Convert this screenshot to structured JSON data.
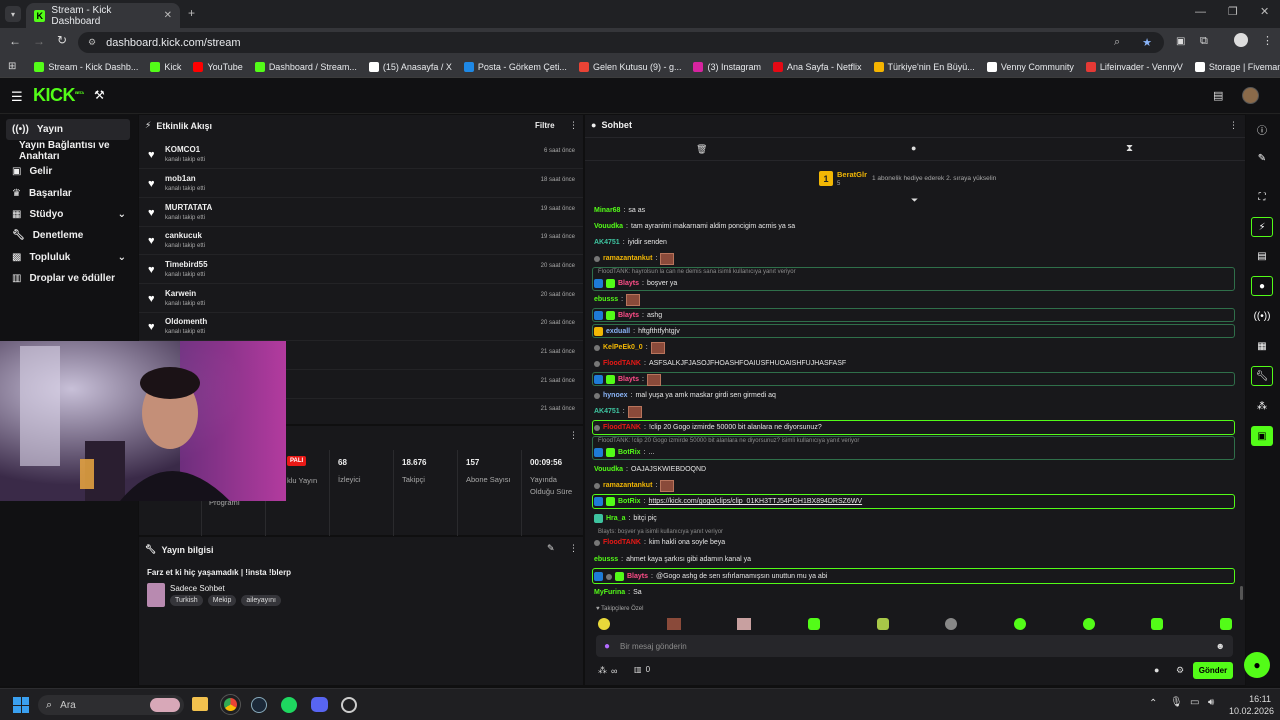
{
  "browser": {
    "tab_title": "Stream - Kick Dashboard",
    "url": "dashboard.kick.com/stream",
    "bookmarks": [
      {
        "label": "Stream - Kick Dashb...",
        "color": "#53fc18"
      },
      {
        "label": "Kick",
        "color": "#53fc18"
      },
      {
        "label": "YouTube",
        "color": "#ff0000"
      },
      {
        "label": "Dashboard / Stream...",
        "color": "#53fc18"
      },
      {
        "label": "(15) Anasayfa / X",
        "color": "#ffffff"
      },
      {
        "label": "Posta - Görkem Çeti...",
        "color": "#1e88e5"
      },
      {
        "label": "Gelen Kutusu (9) - g...",
        "color": "#ea4335"
      },
      {
        "label": "(3) Instagram",
        "color": "#d6249f"
      },
      {
        "label": "Ana Sayfa - Netflix",
        "color": "#e50914"
      },
      {
        "label": "Türkiye'nin En Büyü...",
        "color": "#f5b400"
      },
      {
        "label": "Venny Community",
        "color": "#ffffff"
      },
      {
        "label": "Lifeinvader - VennyV",
        "color": "#e53935"
      },
      {
        "label": "Storage | Fivemanage",
        "color": "#ffffff"
      }
    ]
  },
  "app": {
    "logo": "KICK",
    "logo_sup": "BETA",
    "accent": "#53fc18"
  },
  "sidebar": {
    "items": [
      {
        "label": "Yayın",
        "icon": "broadcast-icon"
      },
      {
        "label": "Yayın Bağlantısı ve Anahtarı",
        "icon": "key-icon"
      },
      {
        "label": "Gelir",
        "icon": "wallet-icon"
      },
      {
        "label": "Başarılar",
        "icon": "trophy-icon"
      },
      {
        "label": "Stüdyo",
        "icon": "studio-icon"
      },
      {
        "label": "Denetleme",
        "icon": "wrench-icon"
      },
      {
        "label": "Topluluk",
        "icon": "community-icon"
      },
      {
        "label": "Droplar ve ödüller",
        "icon": "gift-icon"
      }
    ]
  },
  "activity": {
    "title": "Etkinlik Akışı",
    "filter": "Filtre",
    "rows": [
      {
        "name": "KOMCO1",
        "sub": "kanalı takip etti",
        "time": "6 saat önce"
      },
      {
        "name": "mob1an",
        "sub": "kanalı takip etti",
        "time": "18 saat önce"
      },
      {
        "name": "MURTATATA",
        "sub": "kanalı takip etti",
        "time": "19 saat önce"
      },
      {
        "name": "cankucuk",
        "sub": "kanalı takip etti",
        "time": "19 saat önce"
      },
      {
        "name": "Timebird55",
        "sub": "kanalı takip etti",
        "time": "20 saat önce"
      },
      {
        "name": "Karwein",
        "sub": "kanalı takip etti",
        "time": "20 saat önce"
      },
      {
        "name": "Oldomenth",
        "sub": "kanalı takip etti",
        "time": "20 saat önce"
      },
      {
        "name": "",
        "sub": "",
        "time": "21 saat önce"
      },
      {
        "name": "",
        "sub": "",
        "time": "21 saat önce"
      },
      {
        "name": "",
        "sub": "",
        "time": "21 saat önce"
      }
    ]
  },
  "stats": {
    "live_badge": "PALI",
    "program_label": "Programı",
    "live_label": "klu Yayın",
    "items": [
      {
        "value": "68",
        "label": "İzleyici"
      },
      {
        "value": "18.676",
        "label": "Takipçi"
      },
      {
        "value": "157",
        "label": "Abone Sayısı"
      },
      {
        "value": "00:09:56",
        "label": "Yayında Olduğu Süre"
      }
    ]
  },
  "stream_info": {
    "title": "Yayın bilgisi",
    "stream_title": "Farz et ki hiç yaşamadık | !insta !blerp",
    "category": "Sadece Sohbet",
    "tags": [
      "Turkish",
      "Mekip",
      "aileyayını"
    ]
  },
  "chat": {
    "title": "Sohbet",
    "pinned_user": "BeratGlr",
    "pinned_rank": "1",
    "pinned_level": "5",
    "pinned_text": "1 abonelik hediye ederek 2. sıraya yükselin",
    "input_placeholder": "Bir mesaj gönderin",
    "send_label": "Gönder",
    "points": "∞",
    "count": "0",
    "follower_label": "Takipçilere Özel"
  },
  "messages": {
    "m1": {
      "user": "Minar68",
      "text": "sa as"
    },
    "m2": {
      "user": "Vouudka",
      "text": "tam ayranimi makarnami aldim poncigim acmis ya sa"
    },
    "m3": {
      "user": "AK4751",
      "text": "iyidir senden"
    },
    "m4": {
      "user": "ramazantankut",
      "text": ""
    },
    "r5": "FloodTANK: hayrolsun la can ne demis sana isimli kullanıcıya yanıt veriyor",
    "m5": {
      "user": "Blayts",
      "text": "boşver ya"
    },
    "m6": {
      "user": "ebusss",
      "text": ""
    },
    "m7": {
      "user": "Blayts",
      "text": "ashg"
    },
    "m8": {
      "user": "exduall",
      "text": "hftgfthtfyhtgjv"
    },
    "m9": {
      "user": "KelPeEk0_0",
      "text": ""
    },
    "m10": {
      "user": "FloodTANK",
      "text": "ASFSALKJFJASOJFHOASHFOAIUSFHUOAISHFUJHASFASF"
    },
    "m11": {
      "user": "Blayts",
      "text": ""
    },
    "m12": {
      "user": "hynoex",
      "text": "mal yuşa ya amk maskar girdi sen girmedi aq"
    },
    "m13": {
      "user": "AK4751",
      "text": ""
    },
    "m14": {
      "user": "FloodTANK",
      "text": "!clip 20 Gogo izmirde 50000 bit alanlara ne diyorsunuz?"
    },
    "r15": "FloodTANK: !clip 20 Gogo izmirde 50000 bit alanlara ne diyorsunuz? isimli kullanıcıya yanıt veriyor",
    "m15": {
      "user": "BotRix",
      "text": "..."
    },
    "m16": {
      "user": "Vouudka",
      "text": "OAJAJSKWIEBDOQND"
    },
    "m17": {
      "user": "ramazantankut",
      "text": ""
    },
    "m18": {
      "user": "BotRix",
      "text": "https://kick.com/gogo/clips/clip_01KH3TTJ54PGH1BX894DRSZ6WV"
    },
    "m19": {
      "user": "Hra_a",
      "text": "bitçi piç"
    },
    "r20": "Blayts: boşver ya isimli kullanıcıya yanıt veriyor",
    "m20": {
      "user": "FloodTANK",
      "text": "kim hakli ona soyle beya"
    },
    "m21": {
      "user": "ebusss",
      "text": "ahmet kaya şarkısı gibi adamın kanal ya"
    },
    "m22": {
      "user": "Blayts",
      "text": "@Gogo ashg de sen sıfırlamamışsın unuttun mu ya abi"
    },
    "m23": {
      "user": "MyFurina",
      "text": "Sa"
    }
  },
  "taskbar": {
    "search_placeholder": "Ara",
    "time": "16:11",
    "date": "10.02.2026"
  }
}
